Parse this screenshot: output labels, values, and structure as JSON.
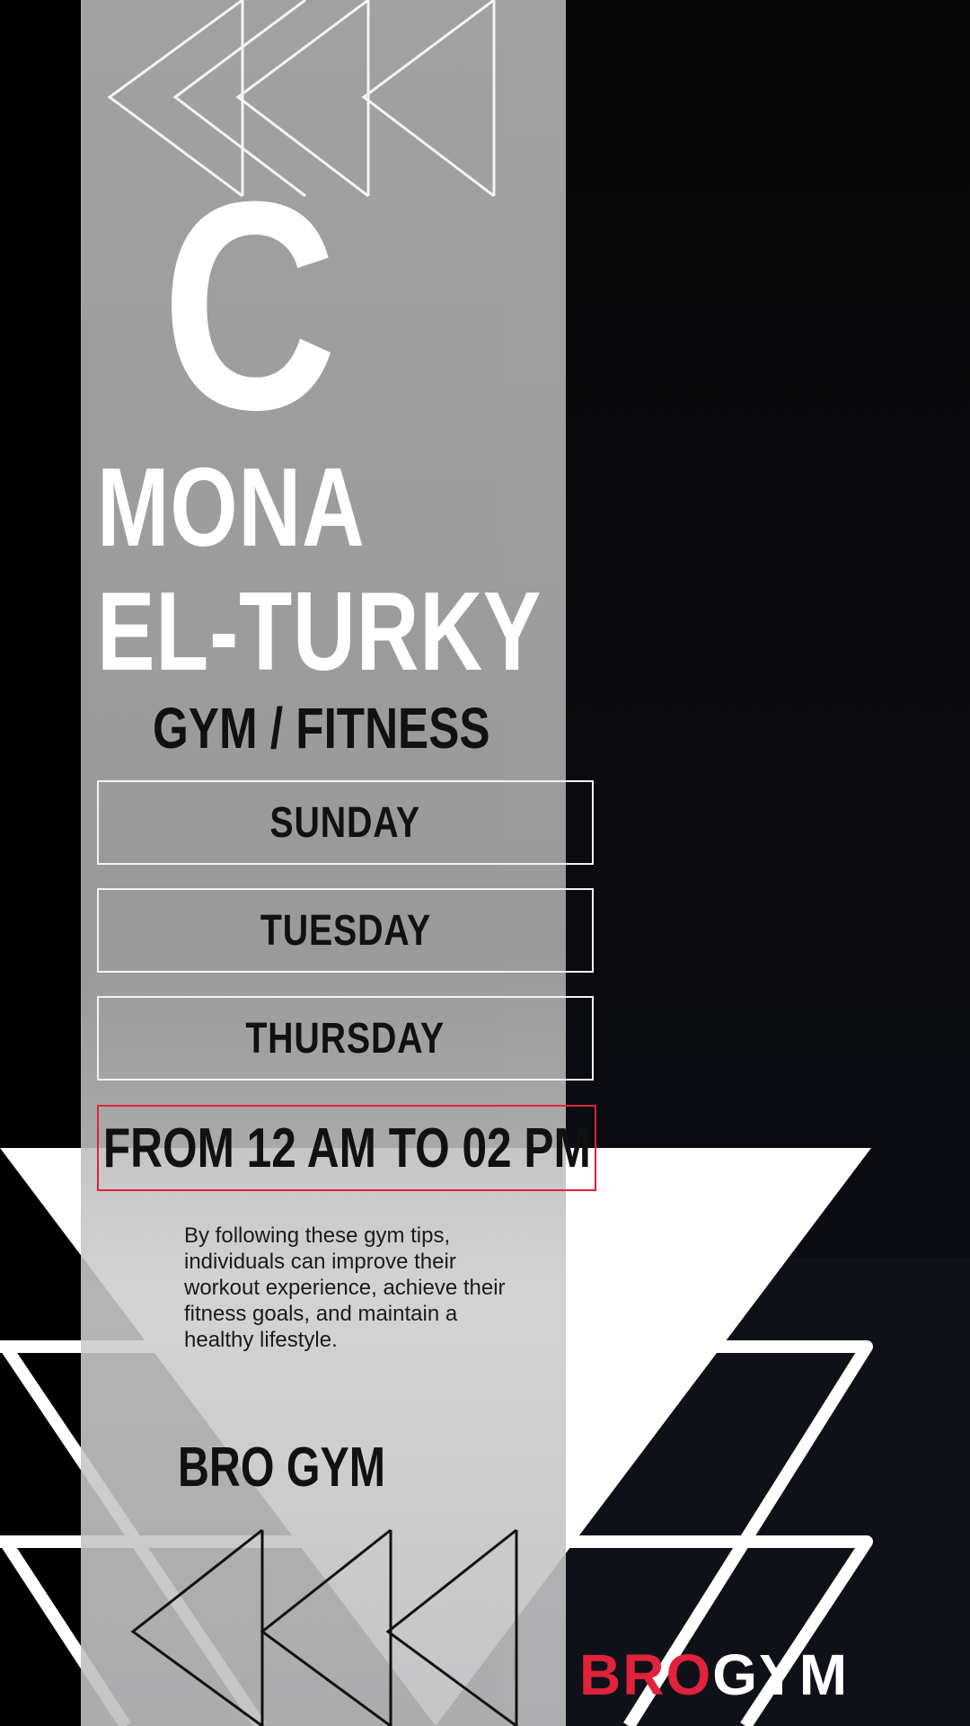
{
  "poster": {
    "initial": "C",
    "name_line1": "MONA",
    "name_line2": "EL-TURKY",
    "category": "GYM / FITNESS",
    "days": [
      "SUNDAY",
      "TUESDAY",
      "THURSDAY"
    ],
    "time": "FROM 12 AM TO 02 PM",
    "tips": "By following these gym tips, individuals can improve their workout experience, achieve their fitness goals, and maintain a healthy lifestyle.",
    "brand": "BRO GYM",
    "logo": {
      "part1": "BRO",
      "part2": "GYM"
    }
  },
  "colors": {
    "accent": "#e0223a",
    "panel": "#b0b0b0",
    "background": "#000000",
    "navy": "#0f1119",
    "text_dark": "#111111",
    "text_light": "#ffffff"
  },
  "icons": [
    "chevron-left-icon",
    "triangle-outline-icon",
    "photo-placeholder"
  ]
}
